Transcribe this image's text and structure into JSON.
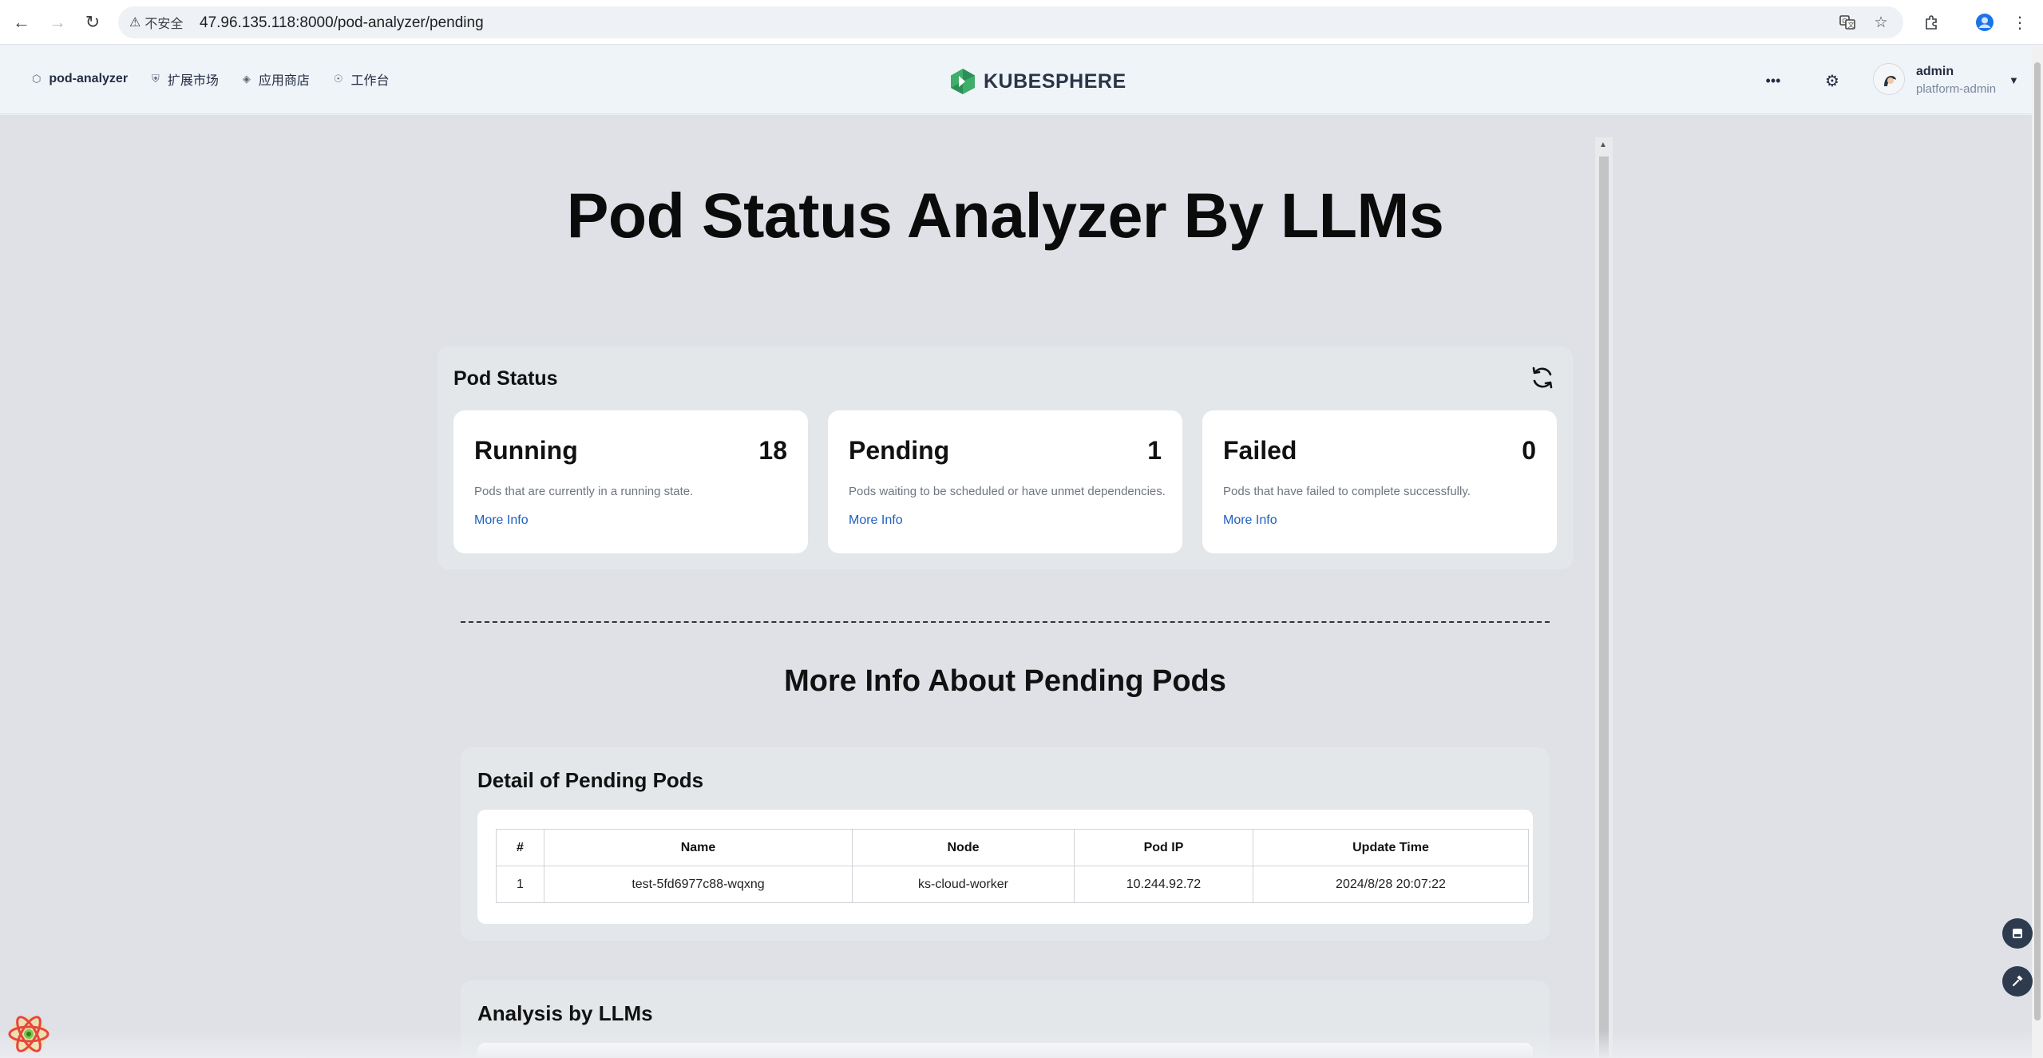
{
  "browser": {
    "security_label": "不安全",
    "url": "47.96.135.118:8000/pod-analyzer/pending"
  },
  "header": {
    "nav": [
      {
        "label": "pod-analyzer",
        "icon": "cube-icon"
      },
      {
        "label": "扩展市场",
        "icon": "shield-icon"
      },
      {
        "label": "应用商店",
        "icon": "layers-icon"
      },
      {
        "label": "工作台",
        "icon": "compass-icon"
      }
    ],
    "logo_text": "KUBESPHERE",
    "user": {
      "name": "admin",
      "role": "platform-admin"
    }
  },
  "page": {
    "title": "Pod Status Analyzer By LLMs",
    "status_panel": {
      "title": "Pod Status",
      "cards": [
        {
          "title": "Running",
          "count": "18",
          "description": "Pods that are currently in a running state.",
          "link": "More Info"
        },
        {
          "title": "Pending",
          "count": "1",
          "description": "Pods waiting to be scheduled or have unmet dependencies.",
          "link": "More Info"
        },
        {
          "title": "Failed",
          "count": "0",
          "description": "Pods that have failed to complete successfully.",
          "link": "More Info"
        }
      ]
    },
    "section_title": "More Info About Pending Pods",
    "detail": {
      "title": "Detail of Pending Pods",
      "columns": [
        "#",
        "Name",
        "Node",
        "Pod IP",
        "Update Time"
      ],
      "rows": [
        [
          "1",
          "test-5fd6977c88-wqxng",
          "ks-cloud-worker",
          "10.244.92.72",
          "2024/8/28 20:07:22"
        ]
      ]
    },
    "analysis_title": "Analysis by LLMs"
  },
  "colors": {
    "link": "#1f5fbf",
    "panel_bg": "#e3e7ea",
    "page_bg": "#dfe1e7",
    "logo_green": "#3fae6a"
  }
}
